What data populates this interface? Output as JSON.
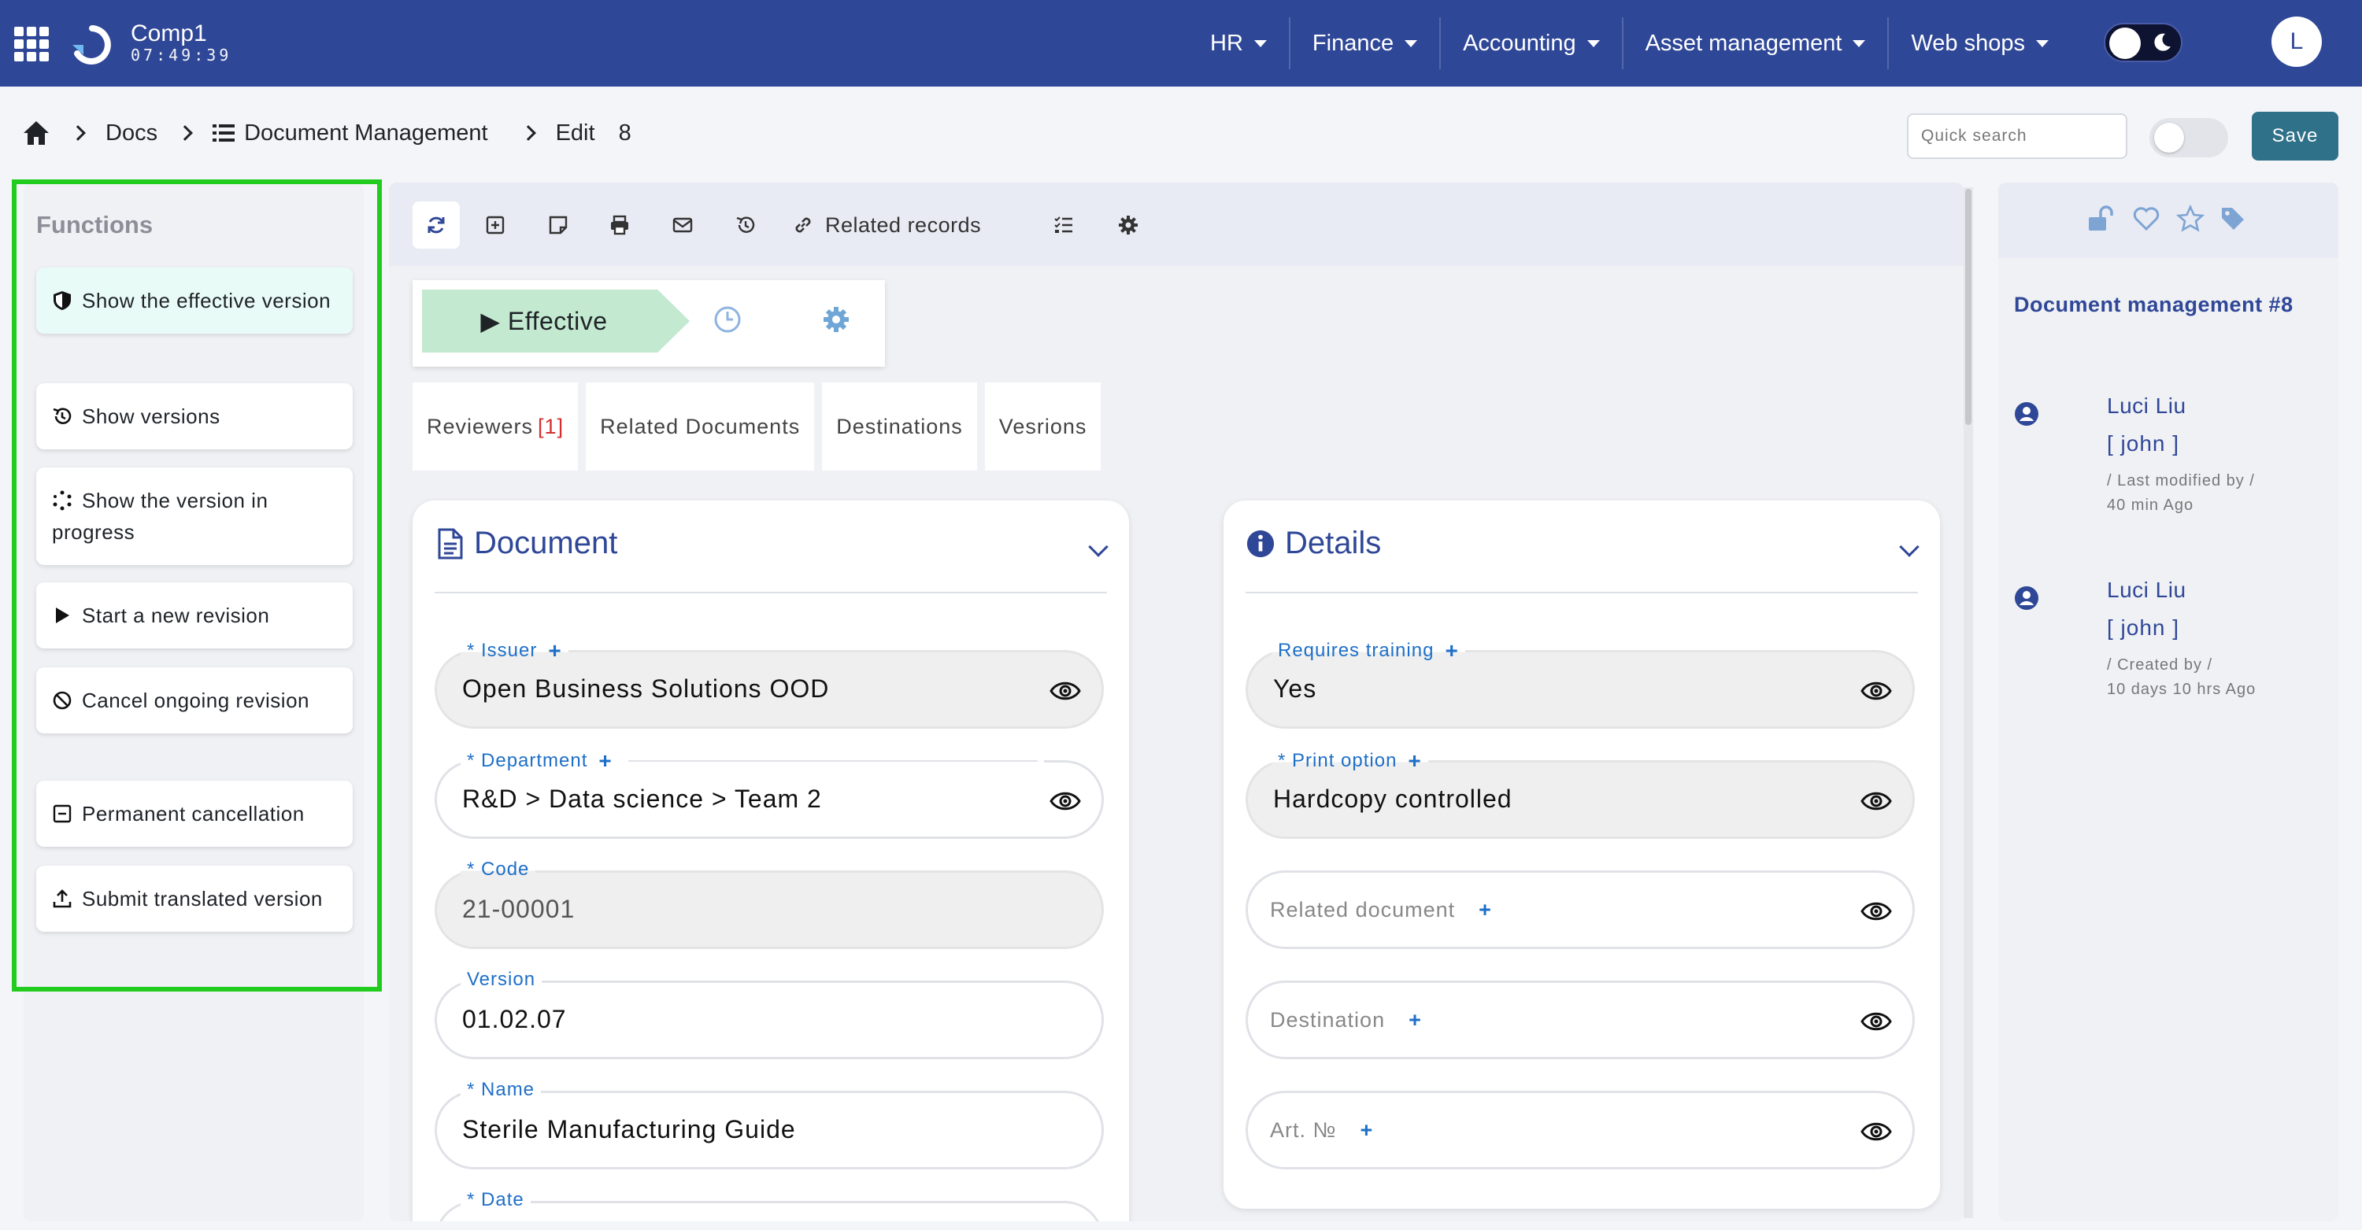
{
  "app": {
    "company": "Comp1",
    "clock": "07:49:39",
    "user_initial": "L"
  },
  "nav": {
    "menus": [
      {
        "label": "HR"
      },
      {
        "label": "Finance"
      },
      {
        "label": "Accounting"
      },
      {
        "label": "Asset management"
      },
      {
        "label": "Web shops"
      }
    ]
  },
  "breadcrumb": {
    "docs": "Docs",
    "module": "Document Management",
    "action": "Edit",
    "record_id": "8"
  },
  "header": {
    "quick_search_placeholder": "Quick search",
    "save_label": "Save"
  },
  "functions": {
    "title": "Functions",
    "items": [
      {
        "label": "Show the effective version",
        "icon": "shield-icon"
      },
      {
        "label": "Show versions",
        "icon": "history-icon"
      },
      {
        "label": "Show the version in progress",
        "icon": "spinner-icon"
      },
      {
        "label": "Start a new revision",
        "icon": "play-icon"
      },
      {
        "label": "Cancel ongoing revision",
        "icon": "ban-icon"
      },
      {
        "label": "Permanent cancellation",
        "icon": "minus-square-icon"
      },
      {
        "label": "Submit translated version",
        "icon": "upload-icon"
      }
    ]
  },
  "toolbar": {
    "related_records": "Related records"
  },
  "status": {
    "label": "▶ Effective"
  },
  "tabs": [
    {
      "label": "Reviewers",
      "count": "[1]"
    },
    {
      "label": "Related Documents",
      "count": ""
    },
    {
      "label": "Destinations",
      "count": ""
    },
    {
      "label": "Vesrions",
      "count": ""
    }
  ],
  "document_card": {
    "title": "Document",
    "fields": {
      "issuer": {
        "label": "* Issuer",
        "value": "Open Business Solutions OOD"
      },
      "department": {
        "label": "* Department",
        "value": "R&D > Data science > Team 2"
      },
      "code": {
        "label": "* Code",
        "value": "21-00001"
      },
      "version": {
        "label": "Version",
        "value": "01.02.07"
      },
      "name": {
        "label": "* Name",
        "value": "Sterile Manufacturing Guide"
      },
      "date": {
        "label": "* Date",
        "value": ""
      }
    }
  },
  "details_card": {
    "title": "Details",
    "fields": {
      "requires_training": {
        "label": "Requires training",
        "value": "Yes"
      },
      "print_option": {
        "label": "* Print option",
        "value": "Hardcopy controlled"
      },
      "related_document": {
        "placeholder": "Related document"
      },
      "destination": {
        "placeholder": "Destination"
      },
      "art_no": {
        "placeholder": "Art. №"
      }
    }
  },
  "record_panel": {
    "title": "Document management #8",
    "history": [
      {
        "name": "Luci Liu",
        "user": "[ john ]",
        "action": "/ Last modified by /",
        "time": "40 min Ago"
      },
      {
        "name": "Luci Liu",
        "user": "[ john ]",
        "action": "/ Created by /",
        "time": "10 days 10 hrs Ago"
      }
    ]
  },
  "colors": {
    "nav": "#2f4797",
    "accent": "#1e6fc8",
    "save": "#2f7189",
    "highlight": "#22cc1f",
    "status": "#c3ead0"
  }
}
